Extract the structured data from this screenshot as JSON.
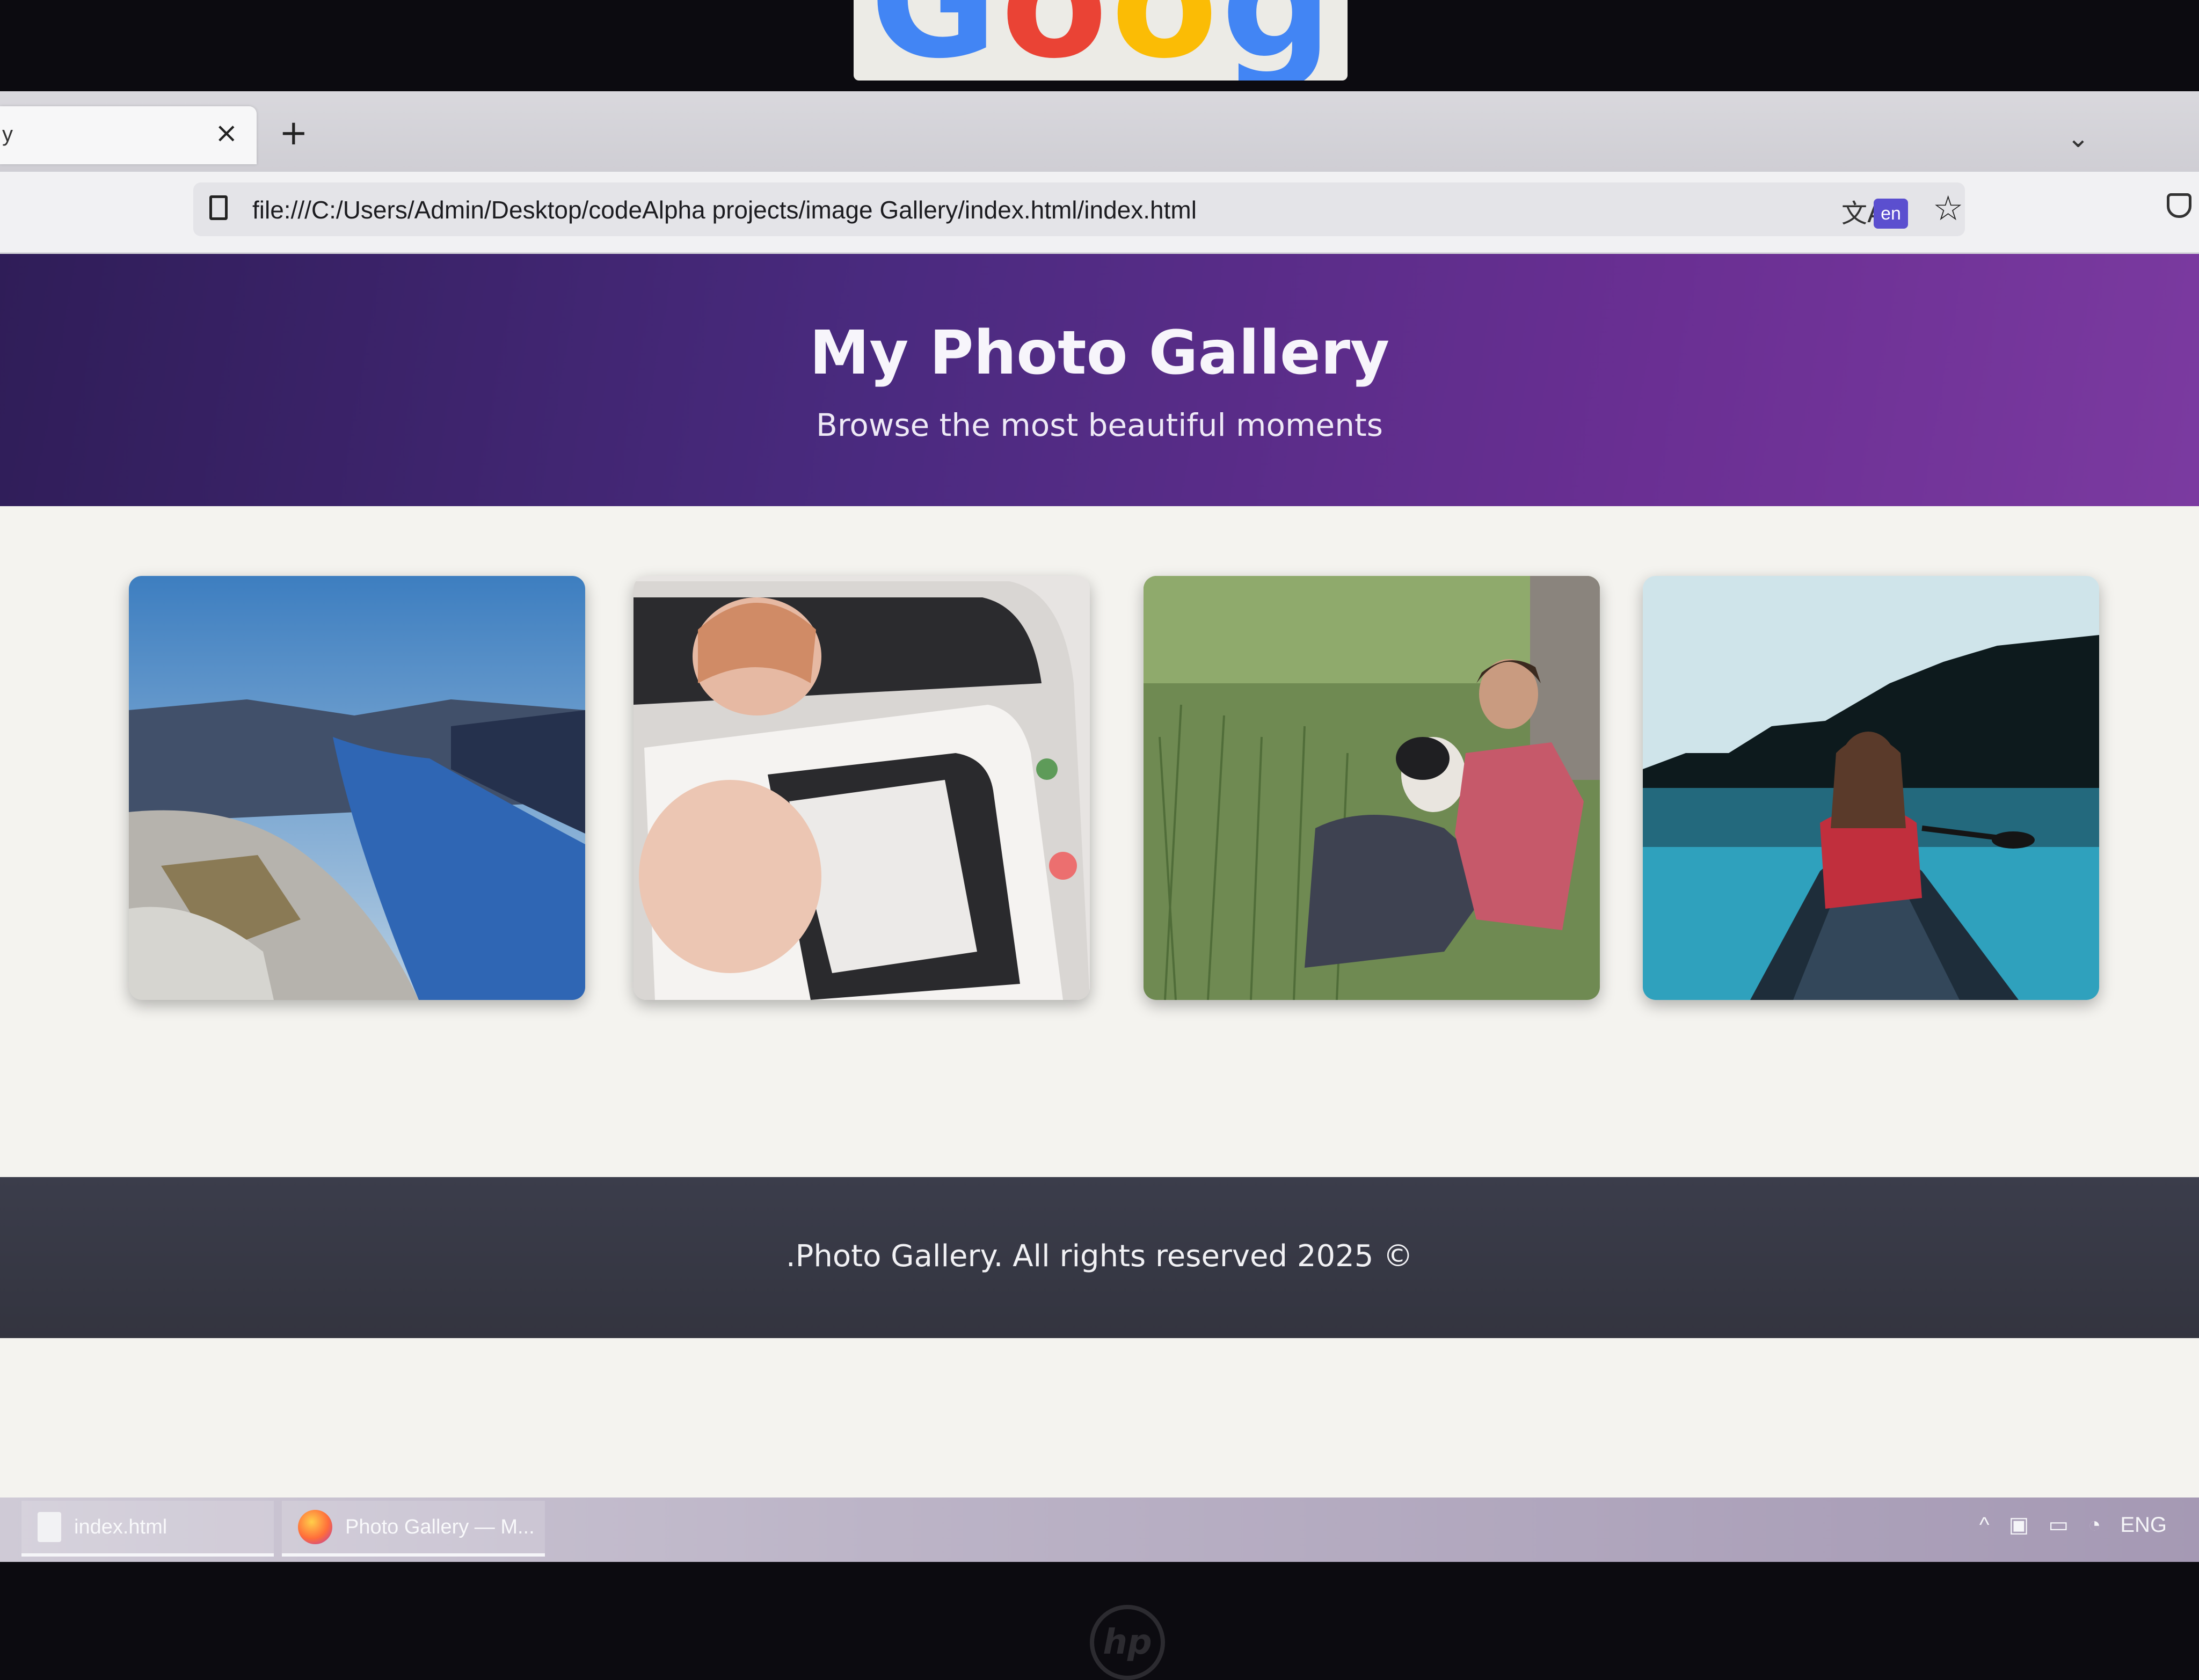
{
  "browser": {
    "tab": {
      "title": "y",
      "close_glyph": "×"
    },
    "new_tab_glyph": "+",
    "tab_list_glyph": "⌄",
    "url": "file:///C:/Users/Admin/Desktop/codeAlpha projects/image Gallery/index.html/index.html",
    "translate_glyph": "文A",
    "translate_badge": "en",
    "star_glyph": "☆"
  },
  "page": {
    "title": "My Photo Gallery",
    "subtitle": "Browse the most beautiful moments",
    "photos": [
      {
        "icon": "fjord-landscape-image"
      },
      {
        "icon": "woman-in-van-image"
      },
      {
        "icon": "man-with-dog-in-grass-image"
      },
      {
        "icon": "woman-in-canoe-image"
      }
    ],
    "footer": ".Photo Gallery. All rights reserved 2025 ©"
  },
  "taskbar": {
    "items": [
      {
        "label": "index.html",
        "icon": "file-icon"
      },
      {
        "label": "Photo Gallery — M...",
        "icon": "firefox-icon"
      }
    ],
    "tray": {
      "chevron": "^",
      "language": "ENG"
    }
  },
  "colors": {
    "hero_start": "#2f1d58",
    "hero_end": "#7b3aa0",
    "footer_bg": "#3b3d4b",
    "page_bg": "#f4f3ef"
  }
}
